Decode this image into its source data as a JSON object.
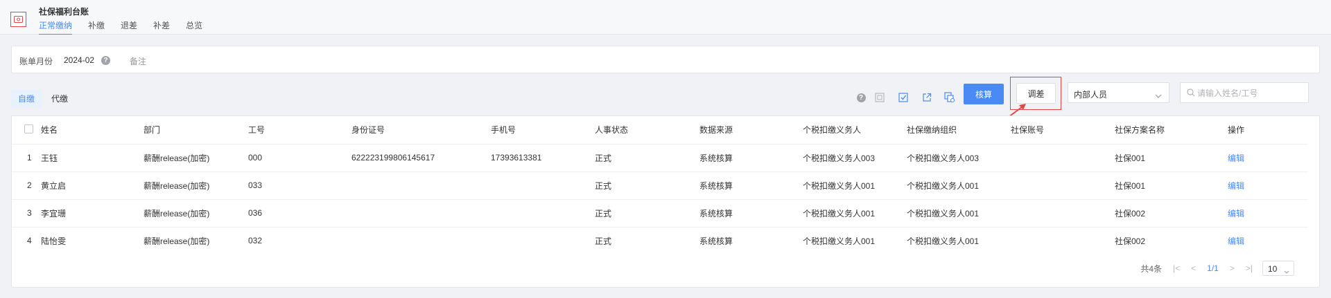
{
  "header": {
    "title": "社保福利台账",
    "tabs": [
      {
        "label": "正常缴纳",
        "active": true
      },
      {
        "label": "补缴",
        "active": false
      },
      {
        "label": "退差",
        "active": false
      },
      {
        "label": "补差",
        "active": false
      },
      {
        "label": "总览",
        "active": false
      }
    ]
  },
  "filter": {
    "month_label": "账单月份",
    "month_value": "2024-02",
    "help": "?",
    "note_label": "备注"
  },
  "toolbar": {
    "sub_tabs": [
      {
        "label": "自缴",
        "active": true
      },
      {
        "label": "代缴",
        "active": false
      }
    ],
    "help": "?",
    "icons": [
      "help-icon",
      "import-icon",
      "checklist-icon",
      "export-icon",
      "copy-settings-icon"
    ],
    "calc_button": "核算",
    "adjust_button": "调差",
    "person_type_select": "内部人员",
    "search_placeholder": "请输入姓名/工号"
  },
  "table": {
    "columns": [
      "姓名",
      "部门",
      "工号",
      "身份证号",
      "手机号",
      "人事状态",
      "数据来源",
      "个税扣缴义务人",
      "社保缴纳组织",
      "社保账号",
      "社保方案名称",
      "操作"
    ],
    "rows": [
      {
        "idx": "1",
        "name": "王钰",
        "dept": "薪酬release(加密)",
        "emp_no": "000",
        "id_no": "622223199806145617",
        "phone": "17393613381",
        "status": "正式",
        "source": "系统核算",
        "tax_agent": "个税扣缴义务人003",
        "org": "个税扣缴义务人003",
        "account": "",
        "plan": "社保001",
        "action": "编辑"
      },
      {
        "idx": "2",
        "name": "黄立启",
        "dept": "薪酬release(加密)",
        "emp_no": "033",
        "id_no": "",
        "phone": "",
        "status": "正式",
        "source": "系统核算",
        "tax_agent": "个税扣缴义务人001",
        "org": "个税扣缴义务人001",
        "account": "",
        "plan": "社保001",
        "action": "编辑"
      },
      {
        "idx": "3",
        "name": "李宜珊",
        "dept": "薪酬release(加密)",
        "emp_no": "036",
        "id_no": "",
        "phone": "",
        "status": "正式",
        "source": "系统核算",
        "tax_agent": "个税扣缴义务人001",
        "org": "个税扣缴义务人001",
        "account": "",
        "plan": "社保002",
        "action": "编辑"
      },
      {
        "idx": "4",
        "name": "陆怡雯",
        "dept": "薪酬release(加密)",
        "emp_no": "032",
        "id_no": "",
        "phone": "",
        "status": "正式",
        "source": "系统核算",
        "tax_agent": "个税扣缴义务人001",
        "org": "个税扣缴义务人001",
        "account": "",
        "plan": "社保002",
        "action": "编辑"
      }
    ]
  },
  "pagination": {
    "total": "共4条",
    "current": "1/1",
    "page_size": "10"
  },
  "colors": {
    "accent": "#4a8af4",
    "highlight_red": "#e54545"
  }
}
